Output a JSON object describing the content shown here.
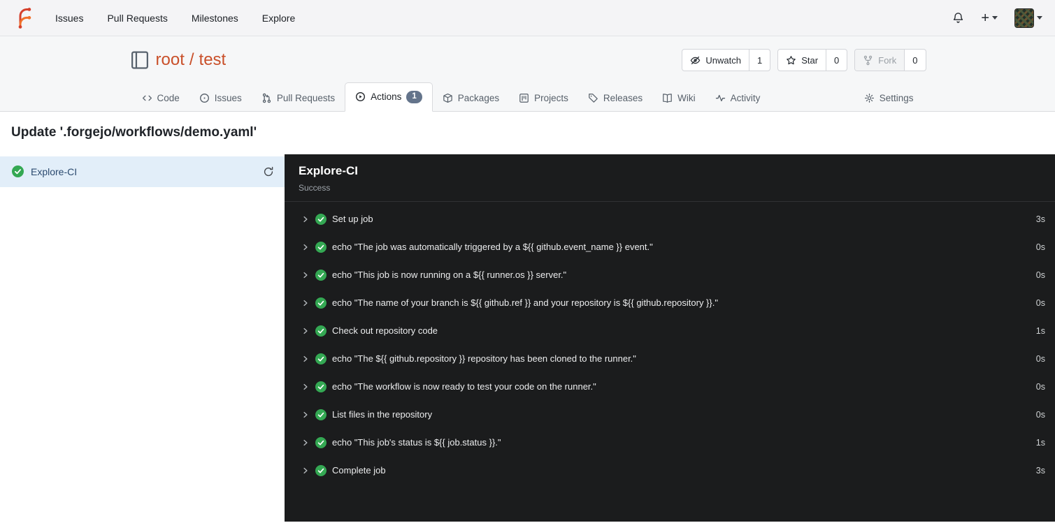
{
  "colors": {
    "primary": "#c9502a",
    "success_green": "#34a853",
    "panel_bg": "#1b1c1d",
    "selected_job_bg": "#e2eef9",
    "badge_bg": "#64748b"
  },
  "icons": {
    "notifications": "bell",
    "create_new": "plus",
    "watch": "eye-slash",
    "star": "star",
    "fork": "git-fork",
    "rerun": "refresh",
    "step_success": "check-circle",
    "step_expand": "chevron-right"
  },
  "topnav": {
    "items": [
      {
        "label": "Issues"
      },
      {
        "label": "Pull Requests"
      },
      {
        "label": "Milestones"
      },
      {
        "label": "Explore"
      }
    ]
  },
  "repo": {
    "owner": "root",
    "separator": "/",
    "name": "test",
    "buttons": [
      {
        "label": "Unwatch",
        "count": "1"
      },
      {
        "label": "Star",
        "count": "0"
      },
      {
        "label": "Fork",
        "count": "0"
      }
    ]
  },
  "tabs": [
    {
      "label": "Code"
    },
    {
      "label": "Issues"
    },
    {
      "label": "Pull Requests"
    },
    {
      "label": "Actions",
      "badge": "1",
      "active": true
    },
    {
      "label": "Packages"
    },
    {
      "label": "Projects"
    },
    {
      "label": "Releases"
    },
    {
      "label": "Wiki"
    },
    {
      "label": "Activity"
    },
    {
      "label": "Settings"
    }
  ],
  "run": {
    "title": "Update '.forgejo/workflows/demo.yaml'",
    "jobs": [
      {
        "name": "Explore-CI",
        "status": "success",
        "selected": true
      }
    ],
    "panel": {
      "title": "Explore-CI",
      "status": "Success"
    },
    "steps": [
      {
        "label": "Set up job",
        "duration": "3s"
      },
      {
        "label": "echo \"The job was automatically triggered by a ${{ github.event_name }} event.\"",
        "duration": "0s"
      },
      {
        "label": "echo \"This job is now running on a ${{ runner.os }} server.\"",
        "duration": "0s"
      },
      {
        "label": "echo \"The name of your branch is ${{ github.ref }} and your repository is ${{ github.repository }}.\"",
        "duration": "0s"
      },
      {
        "label": "Check out repository code",
        "duration": "1s"
      },
      {
        "label": "echo \"The ${{ github.repository }} repository has been cloned to the runner.\"",
        "duration": "0s"
      },
      {
        "label": "echo \"The workflow is now ready to test your code on the runner.\"",
        "duration": "0s"
      },
      {
        "label": "List files in the repository",
        "duration": "0s"
      },
      {
        "label": "echo \"This job's status is ${{ job.status }}.\"",
        "duration": "1s"
      },
      {
        "label": "Complete job",
        "duration": "3s"
      }
    ]
  }
}
